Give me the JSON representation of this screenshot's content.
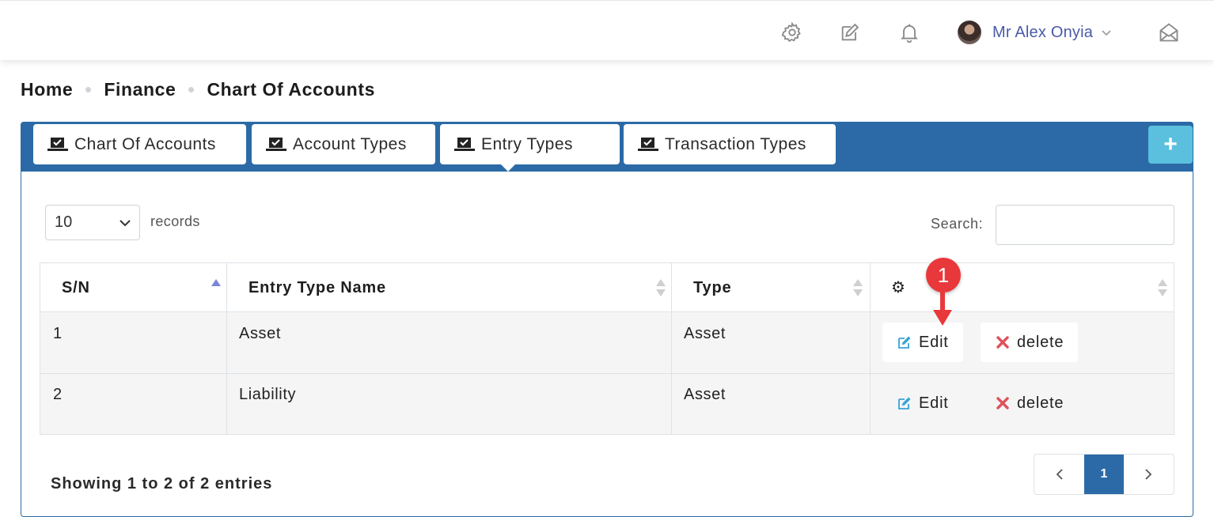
{
  "header": {
    "user_name": "Mr Alex Onyia",
    "icons": [
      "settings-icon",
      "edit-icon",
      "bell-icon",
      "chevron-down-icon",
      "envelope-open-icon"
    ]
  },
  "breadcrumb": [
    "Home",
    "Finance",
    "Chart Of Accounts"
  ],
  "tabs": [
    {
      "label": "Chart Of Accounts",
      "active": false
    },
    {
      "label": "Account Types",
      "active": false
    },
    {
      "label": "Entry Types",
      "active": true
    },
    {
      "label": "Transaction Types",
      "active": false
    }
  ],
  "add_button": "+",
  "table_controls": {
    "page_length": "10",
    "records_label": "records",
    "search_label": "Search:"
  },
  "table": {
    "columns": [
      "S/N",
      "Entry Type Name",
      "Type",
      "⚙"
    ],
    "rows": [
      {
        "sn": "1",
        "name": "Asset",
        "type": "Asset",
        "edit": "Edit",
        "delete": "delete"
      },
      {
        "sn": "2",
        "name": "Liability",
        "type": "Asset",
        "edit": "Edit",
        "delete": "delete"
      }
    ]
  },
  "annotation": {
    "number": "1"
  },
  "footer": {
    "info": "Showing 1 to 2 of 2 entries",
    "current_page": "1"
  },
  "colors": {
    "primary": "#2b6aa6",
    "info": "#5bc0de",
    "danger": "#e9383b",
    "user_link": "#4a5aa8"
  }
}
